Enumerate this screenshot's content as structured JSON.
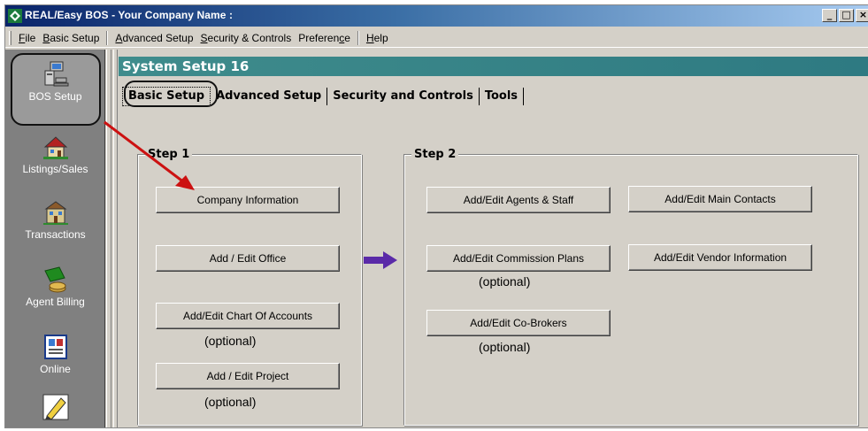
{
  "window": {
    "title": "REAL/Easy BOS - Your Company Name :",
    "controls": [
      "_",
      "□",
      "×"
    ]
  },
  "menubar": {
    "items": [
      {
        "label": "File",
        "accel": "F",
        "rest": "ile"
      },
      {
        "label": "Basic Setup",
        "accel": "B",
        "rest": "asic Setup"
      },
      {
        "label": "Advanced Setup",
        "accel": "A",
        "rest": "dvanced Setup"
      },
      {
        "label": "Security & Controls",
        "accel": "S",
        "rest": "ecurity & Controls"
      },
      {
        "label": "Preference",
        "accel": "",
        "rest": "Preferen",
        "accel2": "c",
        "rest2": "e"
      },
      {
        "label": "Help",
        "accel": "H",
        "rest": "elp"
      }
    ]
  },
  "sidebar": {
    "items": [
      {
        "label": "BOS Setup",
        "icon": "computer-setup-icon"
      },
      {
        "label": "Listings/Sales",
        "icon": "house-icon"
      },
      {
        "label": "Transactions",
        "icon": "building-icon"
      },
      {
        "label": "Agent Billing",
        "icon": "money-icon"
      },
      {
        "label": "Online",
        "icon": "book-icon"
      },
      {
        "label": "",
        "icon": "pencil-icon"
      }
    ]
  },
  "main": {
    "header": "System Setup 16",
    "tabs": [
      "Basic Setup",
      "Advanced Setup",
      "Security and Controls",
      "Tools"
    ],
    "step1": {
      "legend": "Step 1",
      "buttons": [
        "Company Information",
        "Add / Edit Office",
        "Add/Edit Chart Of Accounts",
        "Add / Edit Project"
      ],
      "optional": [
        "(optional)",
        "(optional)"
      ]
    },
    "step2": {
      "legend": "Step 2",
      "buttons": [
        "Add/Edit Agents & Staff",
        "Add/Edit Main Contacts",
        "Add/Edit Commission Plans",
        "Add/Edit Vendor Information",
        "Add/Edit Co-Brokers"
      ],
      "optional": [
        "(optional)",
        "(optional)"
      ]
    }
  },
  "colors": {
    "titlebar": "#0a246a",
    "header": "#3f8c8c",
    "annotation_arrow": "#cc1111",
    "flow_arrow": "#5a2aa8"
  }
}
